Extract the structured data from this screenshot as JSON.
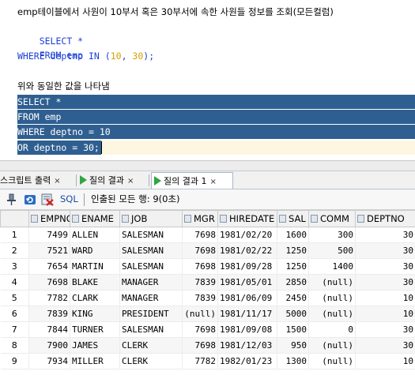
{
  "editor": {
    "comment": "emp테이블에서 사원이 10부서 혹은 30부서에 속한 사원들 정보를 조회(모든컬럼)",
    "query1": {
      "select": "SELECT *",
      "from": "FROM emp",
      "where_kw": "WHERE deptno IN (",
      "n1": "10",
      "sep": ", ",
      "n2": "30",
      "end": ");"
    },
    "comment2": "위와 동일한 값을 나타냄",
    "query2": {
      "select": "SELECT *",
      "from": "FROM emp",
      "where": "WHERE deptno = 10",
      "or": "OR deptno = 30;"
    }
  },
  "tabs": [
    {
      "label": "스크립트 출력",
      "close": "×"
    },
    {
      "label": "질의 결과",
      "close": "×"
    },
    {
      "label": "질의 결과 1",
      "close": "×"
    }
  ],
  "toolbar": {
    "sql_label": "SQL",
    "status": "인출된 모든 행: 9(0초)"
  },
  "grid": {
    "columns": [
      "EMPNO",
      "ENAME",
      "JOB",
      "MGR",
      "HIREDATE",
      "SAL",
      "COMM",
      "DEPTNO"
    ],
    "rows": [
      {
        "n": "1",
        "empno": "7499",
        "ename": "ALLEN",
        "job": "SALESMAN",
        "mgr": "7698",
        "hiredate": "1981/02/20",
        "sal": "1600",
        "comm": "300",
        "deptno": "30"
      },
      {
        "n": "2",
        "empno": "7521",
        "ename": "WARD",
        "job": "SALESMAN",
        "mgr": "7698",
        "hiredate": "1981/02/22",
        "sal": "1250",
        "comm": "500",
        "deptno": "30"
      },
      {
        "n": "3",
        "empno": "7654",
        "ename": "MARTIN",
        "job": "SALESMAN",
        "mgr": "7698",
        "hiredate": "1981/09/28",
        "sal": "1250",
        "comm": "1400",
        "deptno": "30"
      },
      {
        "n": "4",
        "empno": "7698",
        "ename": "BLAKE",
        "job": "MANAGER",
        "mgr": "7839",
        "hiredate": "1981/05/01",
        "sal": "2850",
        "comm": "(null)",
        "deptno": "30"
      },
      {
        "n": "5",
        "empno": "7782",
        "ename": "CLARK",
        "job": "MANAGER",
        "mgr": "7839",
        "hiredate": "1981/06/09",
        "sal": "2450",
        "comm": "(null)",
        "deptno": "10"
      },
      {
        "n": "6",
        "empno": "7839",
        "ename": "KING",
        "job": "PRESIDENT",
        "mgr": "(null)",
        "hiredate": "1981/11/17",
        "sal": "5000",
        "comm": "(null)",
        "deptno": "10"
      },
      {
        "n": "7",
        "empno": "7844",
        "ename": "TURNER",
        "job": "SALESMAN",
        "mgr": "7698",
        "hiredate": "1981/09/08",
        "sal": "1500",
        "comm": "0",
        "deptno": "30"
      },
      {
        "n": "8",
        "empno": "7900",
        "ename": "JAMES",
        "job": "CLERK",
        "mgr": "7698",
        "hiredate": "1981/12/03",
        "sal": "950",
        "comm": "(null)",
        "deptno": "30"
      },
      {
        "n": "9",
        "empno": "7934",
        "ename": "MILLER",
        "job": "CLERK",
        "mgr": "7782",
        "hiredate": "1982/01/23",
        "sal": "1300",
        "comm": "(null)",
        "deptno": "10"
      }
    ]
  },
  "colors": {
    "selection": "#2f5f91",
    "keyword": "#1c3fd8",
    "number": "#d7a000",
    "run_icon": "#2fa640"
  },
  "icons": [
    "pin-icon",
    "refresh-icon",
    "cancel-query-icon",
    "run-triangle-icon"
  ]
}
